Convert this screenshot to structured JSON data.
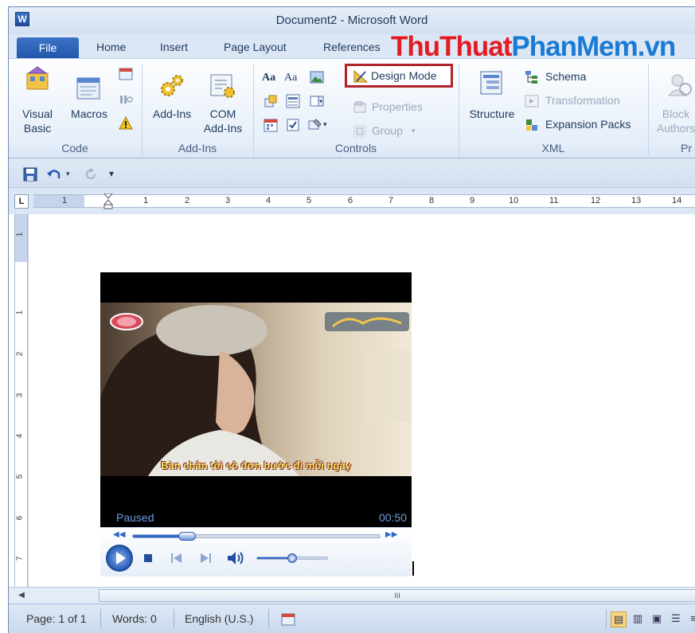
{
  "window": {
    "title": "Document2  -  Microsoft Word",
    "app_icon_letter": "W"
  },
  "tabs": {
    "file": "File",
    "items": [
      "Home",
      "Insert",
      "Page Layout",
      "References"
    ]
  },
  "watermark": {
    "part1": "ThuThuat",
    "part2": "PhanMem.vn"
  },
  "ribbon": {
    "code": {
      "label": "Code",
      "visual_basic": [
        "Visual",
        "Basic"
      ],
      "macros": "Macros"
    },
    "addins": {
      "label": "Add-Ins",
      "addins": "Add-Ins",
      "com_addins": [
        "COM",
        "Add-Ins"
      ]
    },
    "controls": {
      "label": "Controls",
      "design_mode": "Design Mode",
      "properties": "Properties",
      "group": "Group"
    },
    "xml": {
      "label": "XML",
      "structure": "Structure",
      "schema": "Schema",
      "transformation": "Transformation",
      "expansion_packs": "Expansion Packs"
    },
    "protect": {
      "block_authors": [
        "Block",
        "Authors"
      ],
      "label": "Pr"
    }
  },
  "ruler": {
    "corner": "L",
    "h_numbers": [
      "1",
      "1",
      "2",
      "3",
      "4",
      "5",
      "6",
      "7",
      "8",
      "9",
      "10",
      "11",
      "12",
      "13",
      "14"
    ],
    "v_numbers": [
      "1",
      "1",
      "2",
      "3",
      "4",
      "5",
      "6",
      "7"
    ]
  },
  "player": {
    "status": "Paused",
    "time": "00:50",
    "lyric": "Bàn chân tôi cô đơn bước đi mỗi ngày",
    "seek_fraction": 0.22,
    "volume_fraction": 0.5
  },
  "scrollbar": {
    "grip": "III"
  },
  "statusbar": {
    "page": "Page: 1 of 1",
    "words": "Words: 0",
    "language": "English (U.S.)"
  },
  "colors": {
    "accent_blue": "#2358ad",
    "highlight_red": "#b1232a",
    "watermark_red": "#e31c23",
    "watermark_blue": "#1a7bd4"
  }
}
